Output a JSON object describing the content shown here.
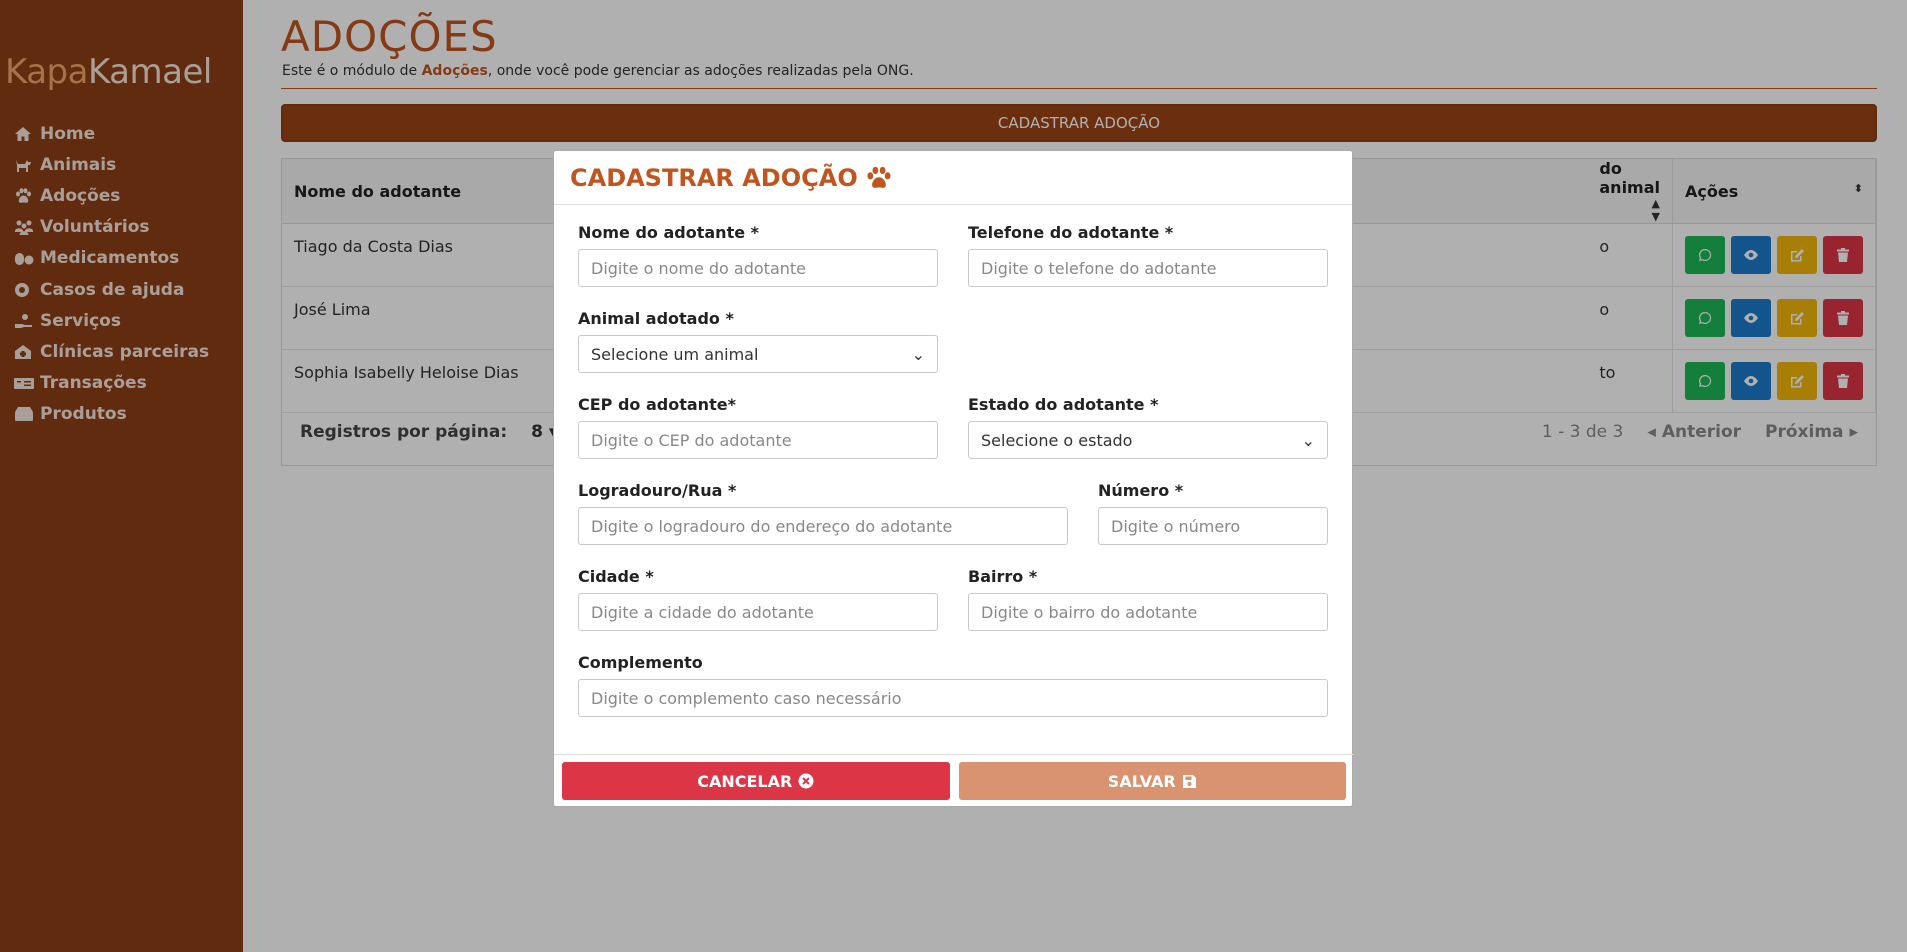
{
  "brand": {
    "part1": "Kapa",
    "part2": "Kamael"
  },
  "sidebar": {
    "items": [
      {
        "label": "Home",
        "icon": "home-icon"
      },
      {
        "label": "Animais",
        "icon": "dog-icon"
      },
      {
        "label": "Adoções",
        "icon": "paw-icon"
      },
      {
        "label": "Voluntários",
        "icon": "people-icon"
      },
      {
        "label": "Medicamentos",
        "icon": "pills-icon"
      },
      {
        "label": "Casos de ajuda",
        "icon": "lifebuoy-icon"
      },
      {
        "label": "Serviços",
        "icon": "hand-helping-icon"
      },
      {
        "label": "Clínicas parceiras",
        "icon": "clinic-icon"
      },
      {
        "label": "Transações",
        "icon": "money-icon"
      },
      {
        "label": "Produtos",
        "icon": "boxes-icon"
      }
    ]
  },
  "page": {
    "title": "ADOÇÕES",
    "desc_prefix": "Este é o módulo de ",
    "desc_bold": "Adoções",
    "desc_suffix": ", onde você pode gerenciar as adoções realizadas pela ONG.",
    "register_button": "CADASTRAR ADOÇÃO"
  },
  "table": {
    "col1": "Nome do adotante",
    "col2": "do animal",
    "col3": "Ações",
    "rows": [
      {
        "name": "Tiago da Costa Dias",
        "animal": "o"
      },
      {
        "name": "José Lima",
        "animal": "o"
      },
      {
        "name": "Sophia Isabelly Heloise Dias",
        "animal": "to"
      }
    ],
    "pagination": {
      "label": "Registros por página:",
      "per_page": "8",
      "range": "1 - 3 de 3",
      "prev": "Anterior",
      "next": "Próxima"
    }
  },
  "modal": {
    "title": "CADASTRAR ADOÇÃO",
    "fields": {
      "nome": {
        "label": "Nome do adotante *",
        "placeholder": "Digite o nome do adotante"
      },
      "telefone": {
        "label": "Telefone do adotante *",
        "placeholder": "Digite o telefone do adotante"
      },
      "animal": {
        "label": "Animal adotado *",
        "value": "Selecione um animal"
      },
      "cep": {
        "label": "CEP do adotante*",
        "placeholder": "Digite o CEP do adotante"
      },
      "estado": {
        "label": "Estado do adotante *",
        "value": "Selecione o estado"
      },
      "logradouro": {
        "label": "Logradouro/Rua *",
        "placeholder": "Digite o logradouro do endereço do adotante"
      },
      "numero": {
        "label": "Número *",
        "placeholder": "Digite o número"
      },
      "cidade": {
        "label": "Cidade *",
        "placeholder": "Digite a cidade do adotante"
      },
      "bairro": {
        "label": "Bairro *",
        "placeholder": "Digite o bairro do adotante"
      },
      "complemento": {
        "label": "Complemento",
        "placeholder": "Digite o complemento caso necessário"
      }
    },
    "cancel": "CANCELAR",
    "save": "SALVAR"
  },
  "colors": {
    "sidebar": "#8d3f16",
    "accent": "#c0561f",
    "cancel": "#dc3545",
    "save": "#d99370",
    "whatsapp": "#1eb856",
    "view": "#1d7acb",
    "edit": "#f2b90a",
    "delete": "#dc3545"
  }
}
